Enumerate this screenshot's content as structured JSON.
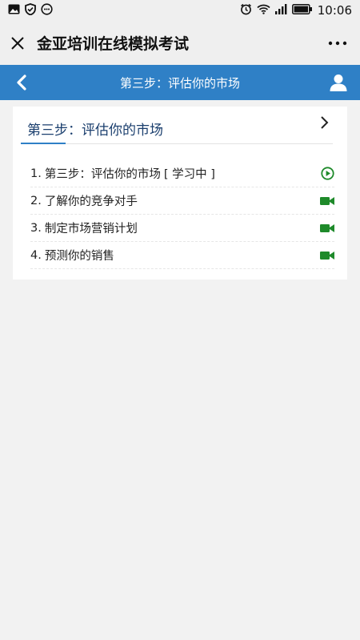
{
  "status_bar": {
    "time": "10:06",
    "icons_left": [
      "image-icon",
      "shield-icon",
      "message-icon"
    ],
    "icons_right": [
      "alarm-icon",
      "wifi-icon",
      "signal-icon",
      "battery-icon"
    ]
  },
  "wechat_header": {
    "title": "金亚培训在线模拟考试",
    "close_icon": "close-icon",
    "more_icon": "more-icon"
  },
  "nav": {
    "title": "第三步：评估你的市场",
    "back_icon": "chevron-left-icon",
    "user_icon": "user-icon",
    "color": "#2f80c6"
  },
  "card": {
    "title": "第三步：评估你的市场",
    "chevron_icon": "chevron-right-icon",
    "lessons": [
      {
        "num": "1.",
        "title": "第三步：评估你的市场",
        "status": "[ 学习中 ]",
        "icon": "play-circle-icon"
      },
      {
        "num": "2.",
        "title": "了解你的竞争对手",
        "status": "",
        "icon": "video-icon"
      },
      {
        "num": "3.",
        "title": "制定市场营销计划",
        "status": "",
        "icon": "video-icon"
      },
      {
        "num": "4.",
        "title": "预测你的销售",
        "status": "",
        "icon": "video-icon"
      }
    ],
    "accent_color": "#2f80c6",
    "icon_color": "#1e8a2a"
  }
}
